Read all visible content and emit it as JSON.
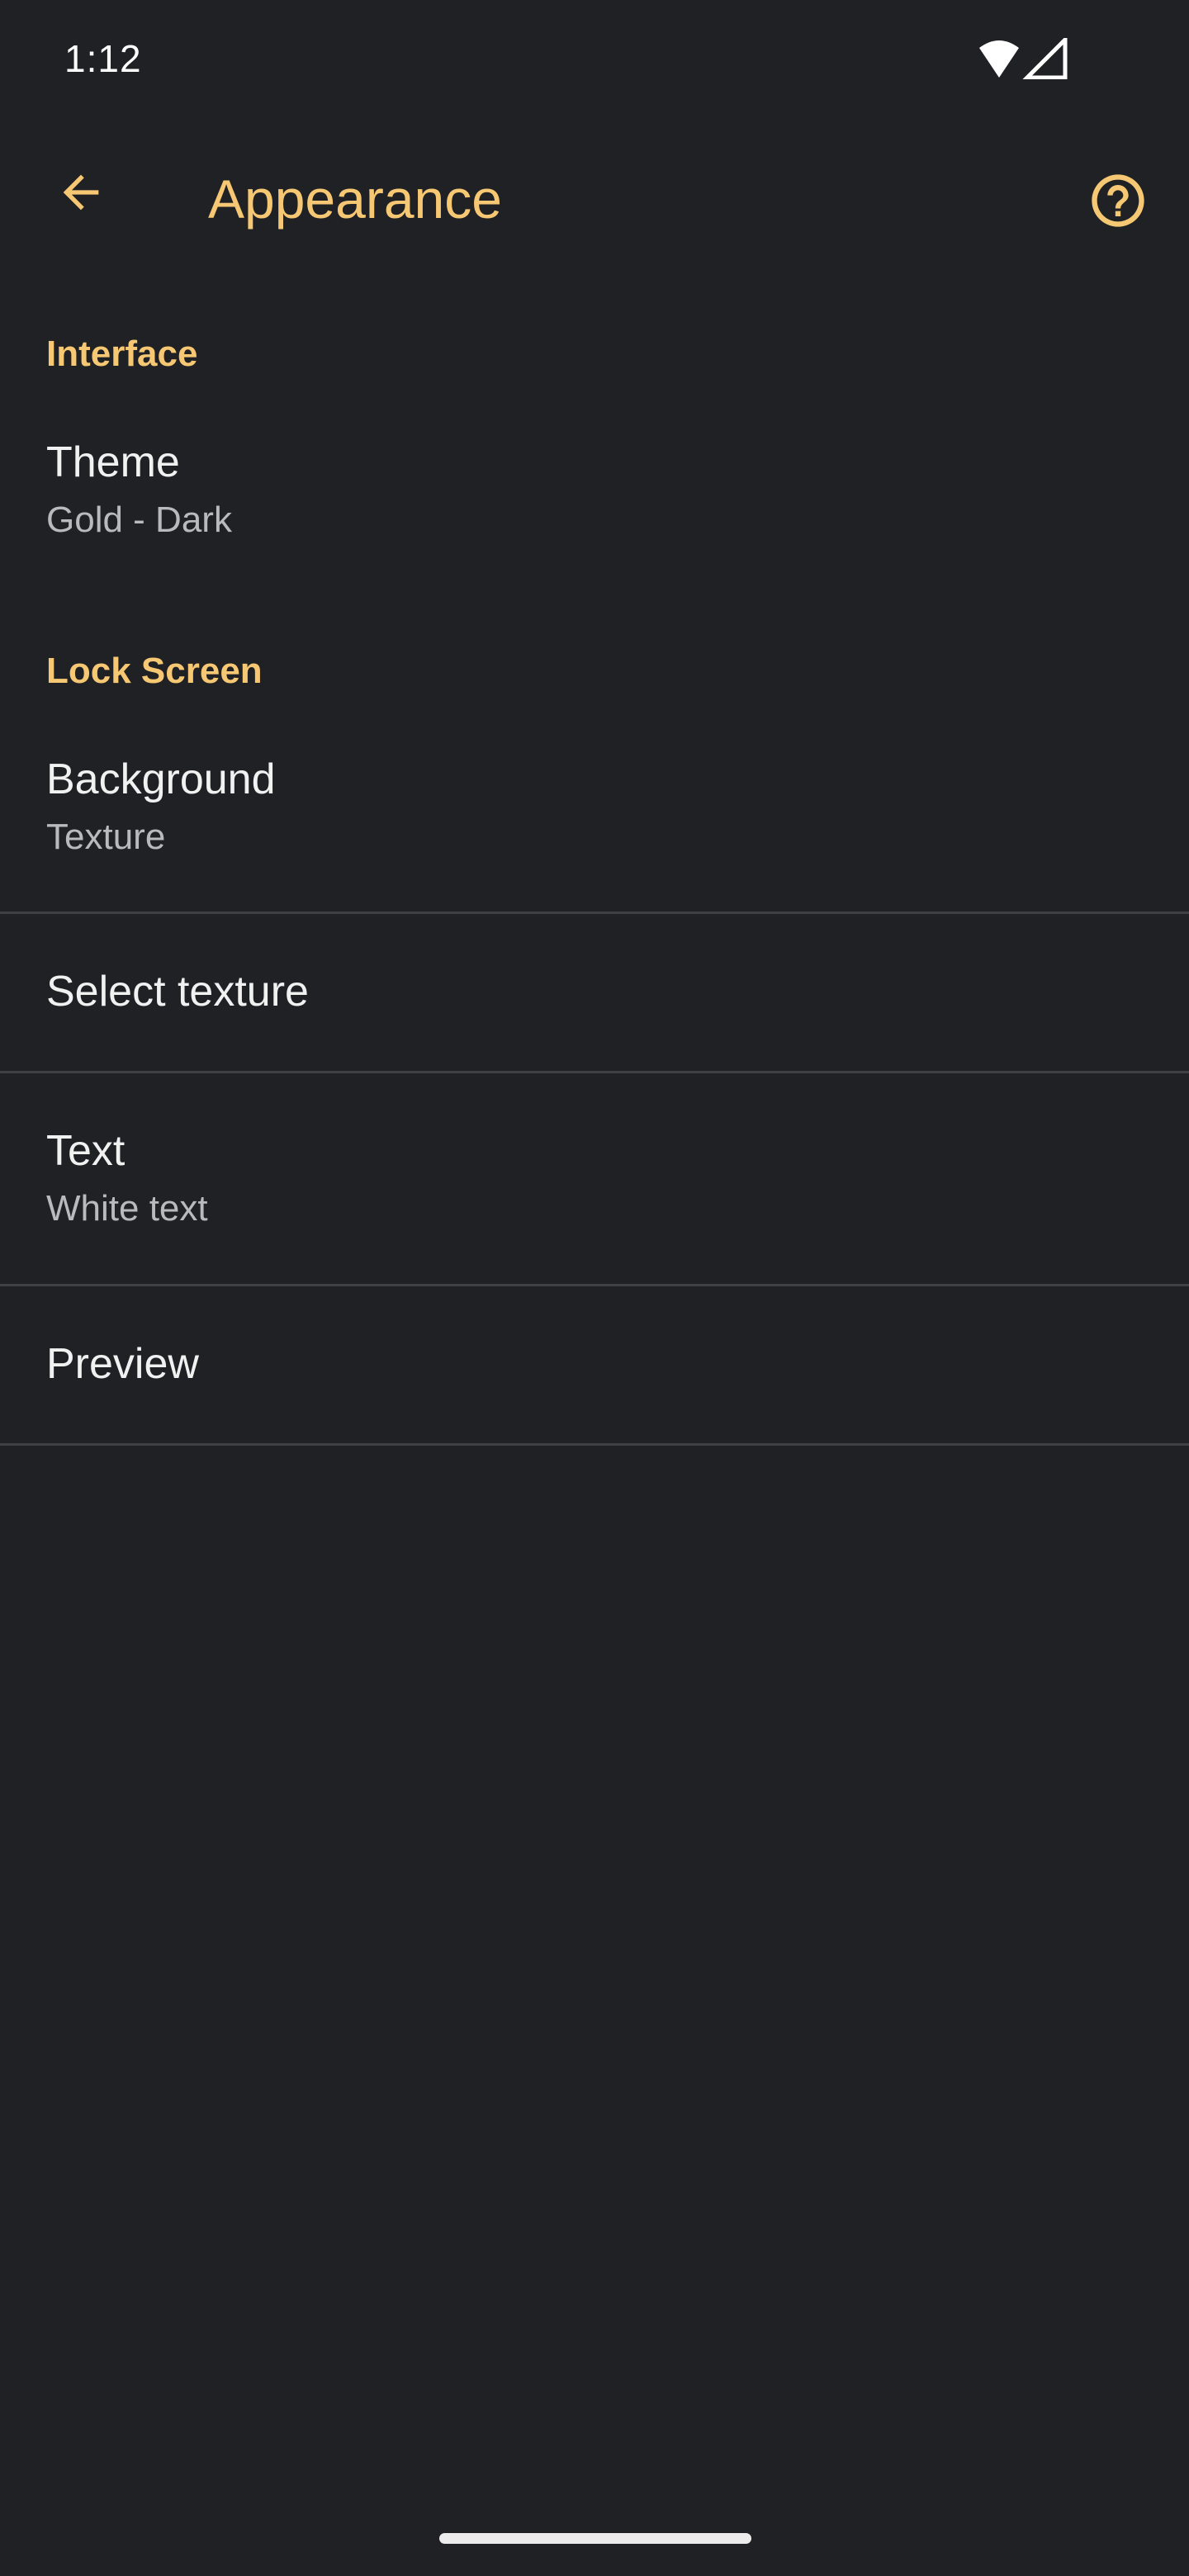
{
  "status_bar": {
    "time": "1:12",
    "icons": [
      "wifi-icon",
      "cell-signal-icon"
    ]
  },
  "app_bar": {
    "title": "Appearance",
    "back_icon": "arrow-back-icon",
    "help_icon": "help-circle-icon"
  },
  "sections": {
    "interface": {
      "header": "Interface",
      "theme": {
        "title": "Theme",
        "summary": "Gold - Dark"
      }
    },
    "lock_screen": {
      "header": "Lock Screen",
      "background": {
        "title": "Background",
        "summary": "Texture"
      },
      "select_texture": {
        "title": "Select texture"
      },
      "text": {
        "title": "Text",
        "summary": "White text"
      },
      "preview": {
        "title": "Preview"
      }
    }
  },
  "colors": {
    "background": "#202124",
    "accent": "#f7c873",
    "primary_text": "#f1f1f1",
    "secondary_text": "#b9babd",
    "divider": "#3f4043"
  }
}
